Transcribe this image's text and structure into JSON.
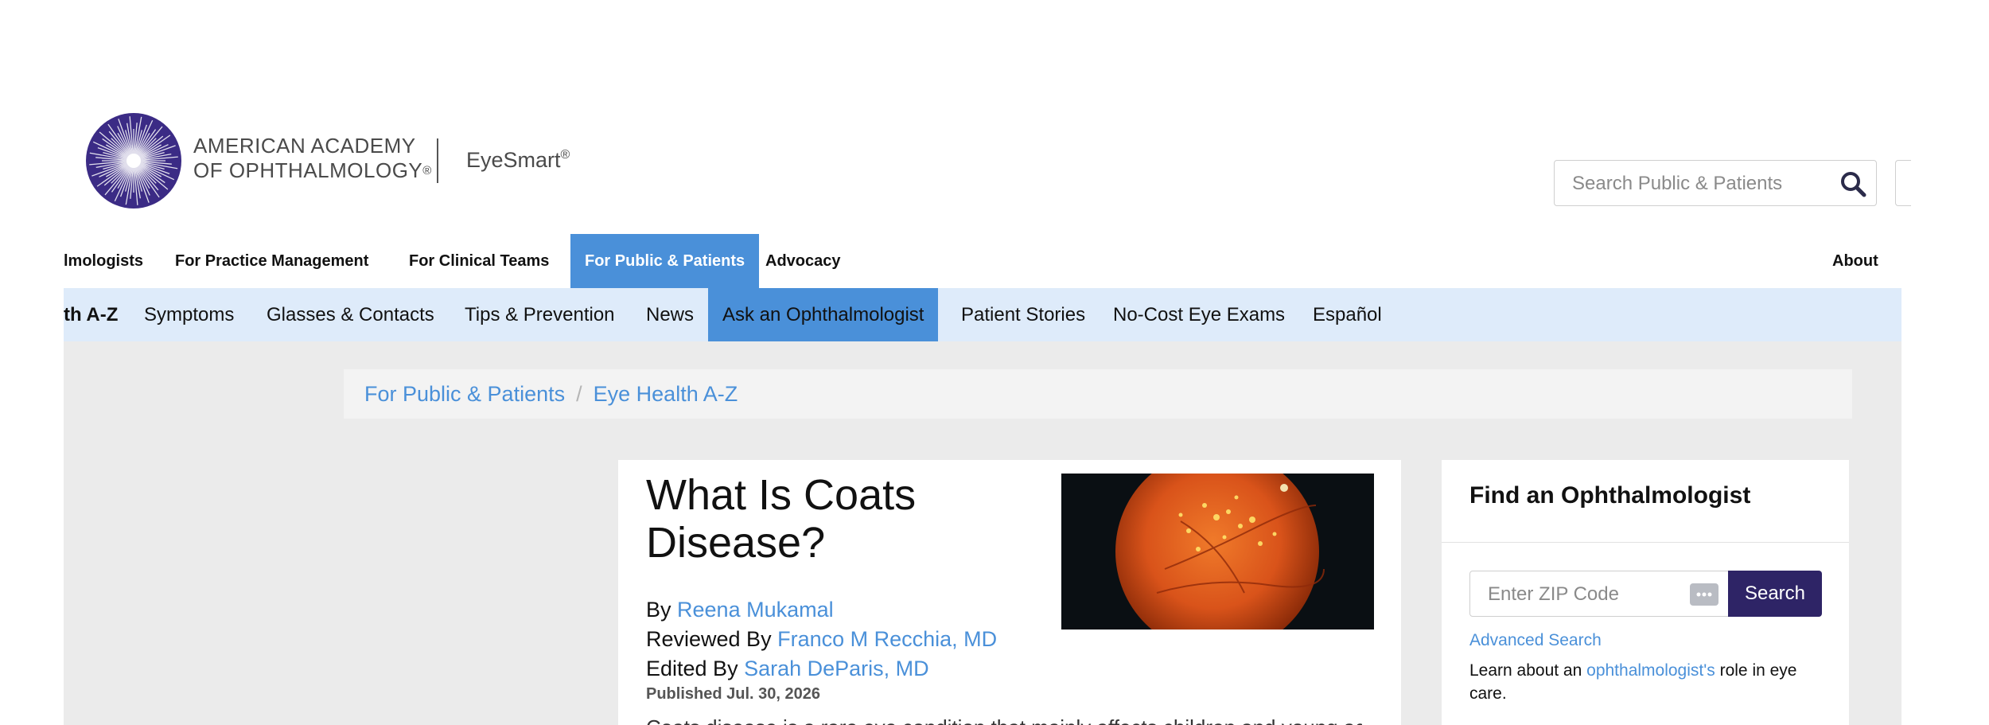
{
  "brand": {
    "org_line1": "AMERICAN ACADEMY",
    "org_line2": "OF OPHTHALMOLOGY",
    "org_reg": "®",
    "site": "EyeSmart",
    "site_reg": "®"
  },
  "search": {
    "placeholder": "Search Public & Patients"
  },
  "topnav": {
    "items": [
      "lmologists",
      "For Practice Management",
      "For Clinical Teams",
      "For Public & Patients",
      "Advocacy",
      "About"
    ],
    "active": "For Public & Patients"
  },
  "subnav": {
    "items": [
      "th A-Z",
      "Symptoms",
      "Glasses & Contacts",
      "Tips & Prevention",
      "News",
      "Ask an Ophthalmologist",
      "Patient Stories",
      "No-Cost Eye Exams",
      "Español"
    ],
    "active": "Ask an Ophthalmologist"
  },
  "breadcrumb": {
    "items": [
      "For Public & Patients",
      "Eye Health A-Z"
    ],
    "separator": "/"
  },
  "article": {
    "title": "What Is Coats Disease?",
    "by_label": "By",
    "author": "Reena Mukamal",
    "reviewed_label": "Reviewed By",
    "reviewer": "Franco M Recchia, MD",
    "edited_label": "Edited By",
    "editor": "Sarah DeParis, MD",
    "published": "Published Jul. 30, 2026",
    "intro": "Coats disease is a rare eye condition that mainly affects children and young adults"
  },
  "finder": {
    "title": "Find an Ophthalmologist",
    "zip_placeholder": "Enter ZIP Code",
    "search_button": "Search",
    "advanced_search": "Advanced Search",
    "learn_prefix": "Learn about an",
    "learn_link": "ophthalmologist's",
    "learn_suffix": "role in eye care."
  },
  "colors": {
    "accent_blue": "#4a90d9",
    "subnav_bg": "#deebfa",
    "brand_purple": "#2e2466",
    "content_bg": "#ebebeb"
  }
}
